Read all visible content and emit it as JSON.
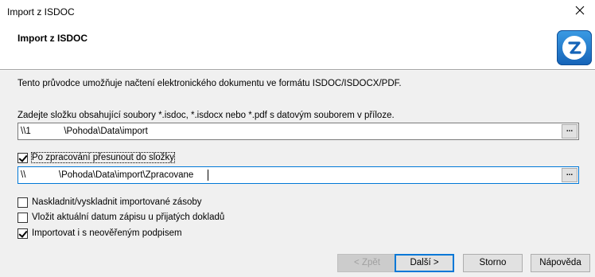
{
  "window": {
    "title": "Import z ISDOC"
  },
  "header": {
    "title": "Import z ISDOC",
    "logo_icon": "pohoda-z-logo"
  },
  "main": {
    "intro": "Tento průvodce umožňuje načtení elektronického dokumentu ve formátu ISDOC/ISDOCX/PDF.",
    "folder_label": "Zadejte složku obsahující soubory *.isdoc, *.isdocx nebo *.pdf s datovým souborem v příloze.",
    "folder_path": "\\\\1             \\Pohoda\\Data\\import",
    "move_checkbox": {
      "label": "Po zpracování přesunout do složky",
      "checked": true
    },
    "move_path": "\\\\             \\Pohoda\\Data\\import\\Zpracovane",
    "browse_label": "...",
    "options": [
      {
        "label": "Naskladnit/vyskladnit importované zásoby",
        "checked": false
      },
      {
        "label": "Vložit aktuální datum zápisu u přijatých dokladů",
        "checked": false
      },
      {
        "label": "Importovat i s neověřeným podpisem",
        "checked": true
      }
    ]
  },
  "buttons": {
    "back": "< Zpět",
    "next": "Další >",
    "cancel": "Storno",
    "help": "Nápověda"
  },
  "colors": {
    "accent": "#0078d7",
    "logo": "#1f7fd6"
  }
}
